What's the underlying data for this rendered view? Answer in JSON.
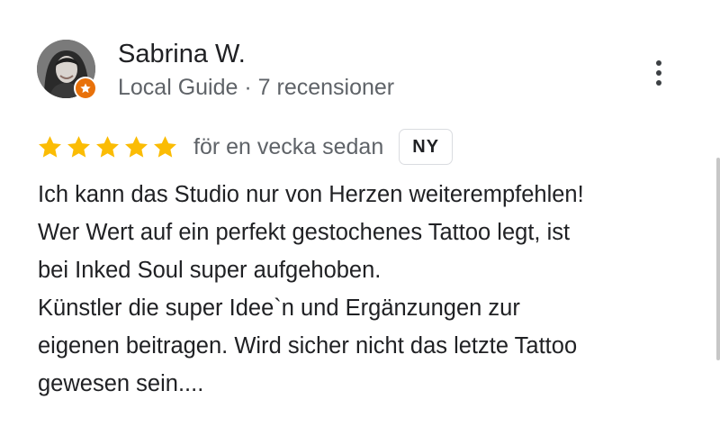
{
  "reviewer": {
    "name": "Sabrina W.",
    "meta": "Local Guide · 7 recensioner"
  },
  "review": {
    "rating": 5,
    "rating_max": 5,
    "date": "för en vecka sedan",
    "badge": "NY",
    "text_lines": [
      "Ich kann das Studio nur von Herzen weiterempfehlen!",
      "Wer Wert auf ein perfekt gestochenes Tattoo legt, ist",
      "bei Inked Soul super aufgehoben.",
      "Künstler die super Idee`n und Ergänzungen zur",
      "eigenen beitragen. Wird sicher nicht das letzte Tattoo",
      "gewesen sein...."
    ]
  },
  "icons": {
    "more": "more-vert-icon",
    "star": "star-icon",
    "guide_badge": "local-guide-star-icon"
  },
  "colors": {
    "star": "#fbbc04",
    "guide_badge": "#e8710a",
    "secondary_text": "#5f6368",
    "primary_text": "#202124"
  }
}
